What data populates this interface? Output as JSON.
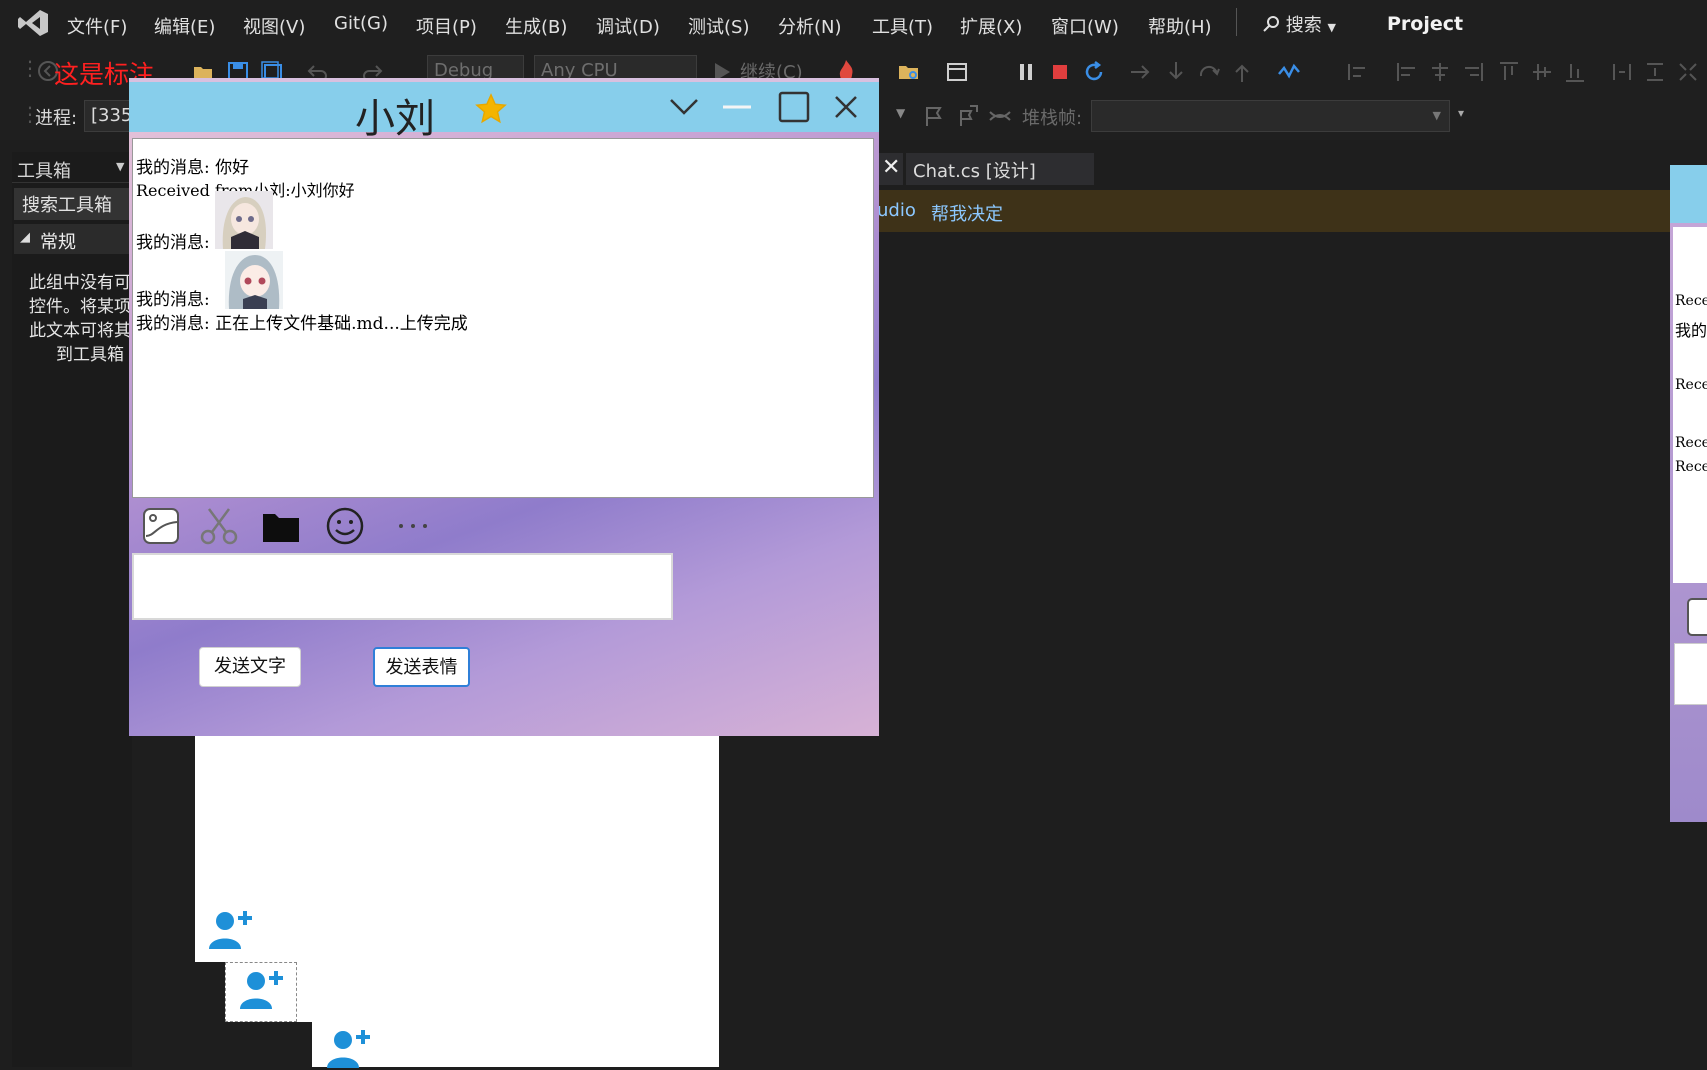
{
  "menu": {
    "items": [
      "文件(F)",
      "编辑(E)",
      "视图(V)",
      "Git(G)",
      "项目(P)",
      "生成(B)",
      "调试(D)",
      "测试(S)",
      "分析(N)",
      "工具(T)",
      "扩展(X)",
      "窗口(W)",
      "帮助(H)"
    ],
    "search_label": "搜索",
    "project_title": "Project"
  },
  "toolbar": {
    "overlay_text": "这是标注",
    "config": "Debug",
    "platform": "Any CPU",
    "continue_label": "继续(C)",
    "process_label": "进程:",
    "process_value": "[335",
    "stackframe_label": "堆栈帧:",
    "stackframe_value": ""
  },
  "toolbox": {
    "title": "工具箱",
    "search": "搜索工具箱",
    "group": "常规",
    "info_lines": [
      "此组中没有可",
      "控件。将某项",
      "此文本可将其",
      "到工具箱"
    ]
  },
  "document": {
    "tab_label": "Chat.cs [设计]",
    "info_partial": "udio",
    "info_link": "帮我决定"
  },
  "chat": {
    "title": "小刘",
    "messages": {
      "m1": "我的消息: 你好",
      "m2": "Received from小刘:小刘你好",
      "m3": "我的消息:",
      "m4": "我的消息:",
      "m5": "我的消息: 正在上传文件基础.md...上传完成"
    },
    "input_value": "",
    "send_text_label": "发送文字",
    "send_emoji_label": "发送表情"
  },
  "preview": {
    "lines": [
      "Rece",
      "我的",
      "Rece",
      "Rece",
      "Rece"
    ]
  },
  "colors": {
    "title_bar": "#87ceeb",
    "star": "#f4b400",
    "add_user": "#1e90d8",
    "stop": "#e03e3e",
    "annotation": "#ff2020"
  }
}
